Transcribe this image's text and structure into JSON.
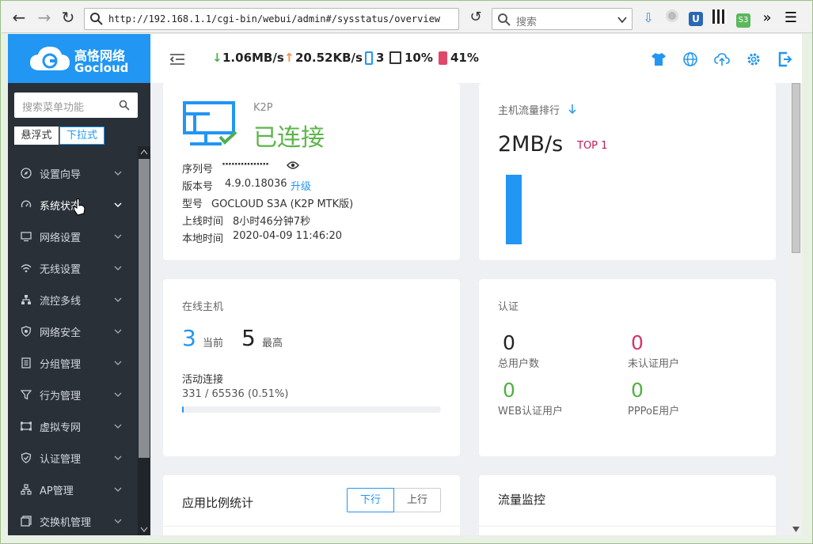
{
  "browser": {
    "url": "http://192.168.1.1/cgi-bin/webui/admin#/sysstatus/overview",
    "search_placeholder": "搜索"
  },
  "brand": {
    "name_cn": "高恪网络",
    "name_en": "Gocloud",
    "color": "#2196f3"
  },
  "header": {
    "download_rate": "1.06MB/s",
    "upload_rate": "20.52KB/s",
    "devices": "3",
    "cpu": "10%",
    "memory": "41%"
  },
  "sidebar": {
    "search_placeholder": "搜索菜单功能",
    "mode_float": "悬浮式",
    "mode_dropdown": "下拉式",
    "items": [
      {
        "label": "设置向导",
        "icon": "compass-icon"
      },
      {
        "label": "系统状态",
        "icon": "gauge-icon"
      },
      {
        "label": "网络设置",
        "icon": "monitor-icon"
      },
      {
        "label": "无线设置",
        "icon": "wifi-icon"
      },
      {
        "label": "流控多线",
        "icon": "network-tree-icon"
      },
      {
        "label": "网络安全",
        "icon": "shield-icon"
      },
      {
        "label": "分组管理",
        "icon": "list-icon"
      },
      {
        "label": "行为管理",
        "icon": "filter-icon"
      },
      {
        "label": "虚拟专网",
        "icon": "vpn-icon"
      },
      {
        "label": "认证管理",
        "icon": "shield-check-icon"
      },
      {
        "label": "AP管理",
        "icon": "ap-icon"
      },
      {
        "label": "交换机管理",
        "icon": "switch-icon"
      }
    ]
  },
  "device": {
    "model_short": "K2P",
    "status": "已连接",
    "serial_label": "序列号",
    "serial_value": "···············",
    "version_label": "版本号",
    "version_value": "4.9.0.18036",
    "upgrade_link": "升级",
    "type_label": "型号",
    "type_value": "GOCLOUD S3A (K2P MTK版)",
    "uptime_label": "上线时间",
    "uptime_value": "8小时46分钟7秒",
    "localtime_label": "本地时间",
    "localtime_value": "2020-04-09 11:46:20"
  },
  "traffic_rank": {
    "title": "主机流量排行",
    "rate": "2MB/s",
    "rank": "TOP 1",
    "bar_fraction": 1
  },
  "online": {
    "title": "在线主机",
    "current": "3",
    "current_label": "当前",
    "max": "5",
    "max_label": "最高",
    "conn_title": "活动连接",
    "conn_value": "331 / 65536 (0.51%)",
    "conn_percent": 0.51
  },
  "auth": {
    "title": "认证",
    "total": "0",
    "total_label": "总用户数",
    "unauth": "0",
    "unauth_label": "未认证用户",
    "web": "0",
    "web_label": "WEB认证用户",
    "pppoe": "0",
    "pppoe_label": "PPPoE用户"
  },
  "app_stats": {
    "title": "应用比例统计",
    "tab_down": "下行",
    "tab_up": "上行"
  },
  "traffic_monitor": {
    "title": "流量监控"
  }
}
